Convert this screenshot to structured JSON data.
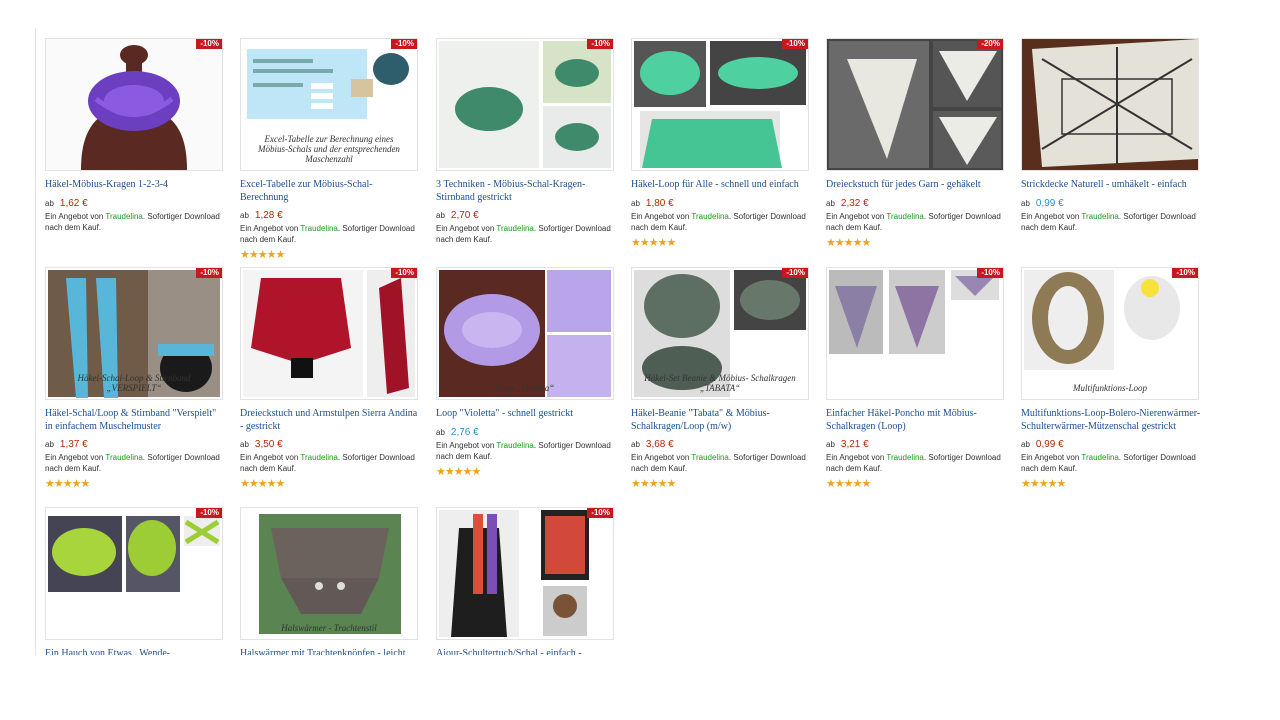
{
  "offer": {
    "prefix": "Ein Angebot von ",
    "seller": "Traudelina",
    "suffix": ". Sofortiger Download nach dem Kauf."
  },
  "price_prefix": "ab",
  "stars": "★★★★★",
  "products": [
    {
      "title": "Häkel-Möbius-Kragen 1-2-3-4",
      "price": "1,62 €",
      "badge": "-10%",
      "stars": false
    },
    {
      "title": "Excel-Tabelle zur Möbius-Schal-Berechnung",
      "price": "1,28 €",
      "badge": "-10%",
      "stars": true,
      "thumb_text": [
        "Excel-Tabelle zur Berechnung",
        "eines Möbius-Schals",
        "und der entsprechenden Maschenzahl"
      ]
    },
    {
      "title": "3 Techniken - Möbius-Schal-Kragen-Stirnband gestrickt",
      "price": "2,70 €",
      "badge": "-10%",
      "stars": false
    },
    {
      "title": "Häkel-Loop für Alle - schnell und einfach",
      "price": "1,80 €",
      "badge": "-10%",
      "stars": true
    },
    {
      "title": "Dreieckstuch für jedes Garn - gehäkelt",
      "price": "2,32 €",
      "badge": "-20%",
      "stars": true
    },
    {
      "title": "Strickdecke Naturell - umhäkelt - einfach",
      "price": "0,99 €",
      "badge": "",
      "stars": false,
      "blue": true
    },
    {
      "title": "Häkel-Schal/Loop & Stirnband \"Verspielt\" in einfachem Muschelmuster",
      "price": "1,37 €",
      "badge": "-10%",
      "stars": true,
      "thumb_text": [
        "Häkel-Schal-Loop",
        "& Stirnband",
        "„VERSPIELT“"
      ]
    },
    {
      "title": "Dreieckstuch und Armstulpen Sierra Andina - gestrickt",
      "price": "3,50 €",
      "badge": "-10%",
      "stars": true
    },
    {
      "title": "Loop \"Violetta\" - schnell gestrickt",
      "price": "2,76 €",
      "badge": "",
      "stars": true,
      "blue": true,
      "thumb_text": [
        "Loop „Violetta“"
      ]
    },
    {
      "title": "Häkel-Beanie \"Tabata\" & Möbius-Schalkragen/Loop (m/w)",
      "price": "3,68 €",
      "badge": "-10%",
      "stars": true,
      "thumb_text": [
        "Häkel-Set",
        "Beanie & Möbius-",
        "Schalkragen",
        "„TABATA“"
      ]
    },
    {
      "title": "Einfacher Häkel-Poncho mit Möbius-Schalkragen (Loop)",
      "price": "3,21 €",
      "badge": "-10%",
      "stars": true
    },
    {
      "title": "Multifunktions-Loop-Bolero-Nierenwärmer-Schulterwärmer-Mützenschal gestrickt",
      "price": "0,99 €",
      "badge": "-10%",
      "stars": true,
      "thumb_text": [
        "Multifunktions-Loop"
      ]
    },
    {
      "title": "Ein Hauch von Etwas.. Wende-Loop/Mützenschal - Einheitsgröße - leicht zu stricken",
      "price": "",
      "badge": "-10%",
      "stars": false
    },
    {
      "title": "Halswärmer mit Trachtenknöpfen - leicht und",
      "price": "",
      "badge": "",
      "stars": false,
      "thumb_text": [
        "Halswärmer - Trachtenstil"
      ]
    },
    {
      "title": "Ajour-Schultertuch/Schal - einfach - gestrickt",
      "price": "",
      "badge": "-10%",
      "stars": false
    }
  ]
}
